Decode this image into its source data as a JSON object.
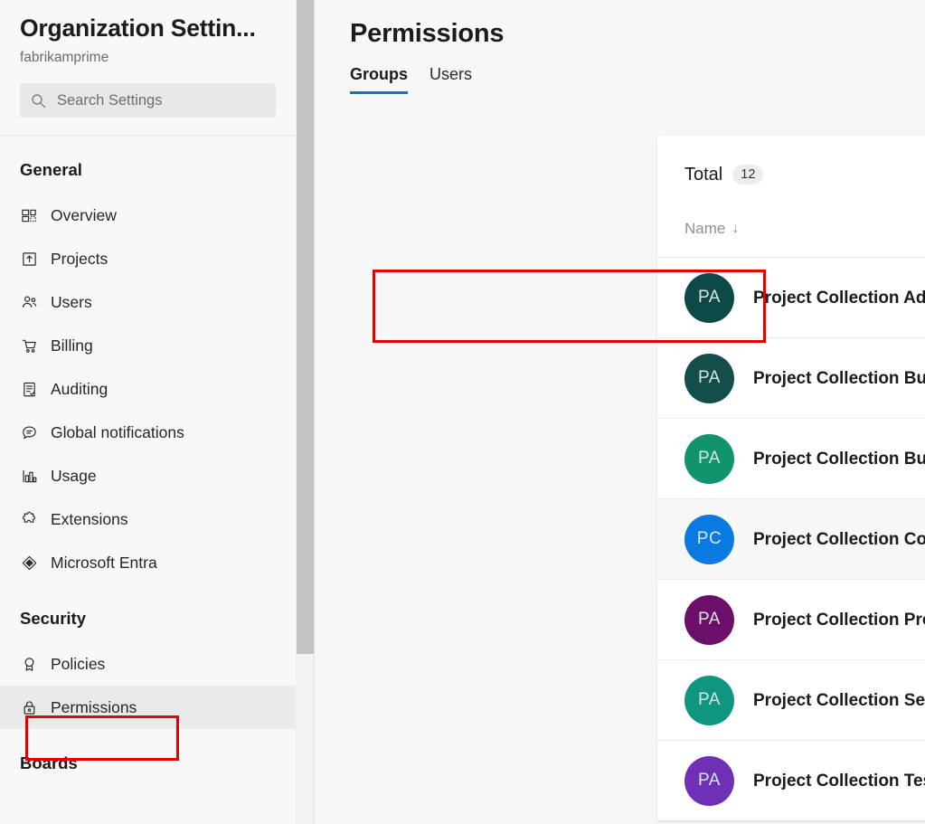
{
  "sidebar": {
    "org_title": "Organization Settin...",
    "org_subtitle": "fabrikamprime",
    "search": {
      "placeholder": "Search Settings",
      "value": "",
      "icon": "search-icon"
    },
    "sections": [
      {
        "title": "General",
        "items": [
          {
            "label": "Overview",
            "icon": "dashboard-icon",
            "selected": false
          },
          {
            "label": "Projects",
            "icon": "project-box-icon",
            "selected": false
          },
          {
            "label": "Users",
            "icon": "people-icon",
            "selected": false
          },
          {
            "label": "Billing",
            "icon": "shopping-cart-icon",
            "selected": false
          },
          {
            "label": "Auditing",
            "icon": "clipboard-check-icon",
            "selected": false
          },
          {
            "label": "Global notifications",
            "icon": "speech-bubble-icon",
            "selected": false
          },
          {
            "label": "Usage",
            "icon": "bar-chart-icon",
            "selected": false
          },
          {
            "label": "Extensions",
            "icon": "puzzle-piece-icon",
            "selected": false
          },
          {
            "label": "Microsoft Entra",
            "icon": "entra-diamond-icon",
            "selected": false
          }
        ]
      },
      {
        "title": "Security",
        "items": [
          {
            "label": "Policies",
            "icon": "ribbon-badge-icon",
            "selected": false
          },
          {
            "label": "Permissions",
            "icon": "lock-icon",
            "selected": true
          }
        ]
      },
      {
        "title": "Boards",
        "items": []
      }
    ]
  },
  "main": {
    "page_title": "Permissions",
    "tabs": [
      {
        "label": "Groups",
        "active": true
      },
      {
        "label": "Users",
        "active": false
      }
    ],
    "total": {
      "label": "Total",
      "count": "12"
    },
    "column_header": {
      "label": "Name",
      "sort_arrow": "↓"
    },
    "rows": [
      {
        "initials": "PA",
        "name": "Project Collection Administrators",
        "color": "#0d4a47",
        "alt": false
      },
      {
        "initials": "PA",
        "name": "Project Collection Build Administrators",
        "color": "#134e4a",
        "alt": false
      },
      {
        "initials": "PA",
        "name": "Project Collection Build Service Accounts",
        "color": "#11946e",
        "alt": false
      },
      {
        "initials": "PC",
        "name": "Project Collection Contributors",
        "color": "#0a7ae0",
        "alt": true
      },
      {
        "initials": "PA",
        "name": "Project Collection Proxy Service Accounts",
        "color": "#6b0f6b",
        "alt": false
      },
      {
        "initials": "PA",
        "name": "Project Collection Service Accounts",
        "color": "#0f9680",
        "alt": false
      },
      {
        "initials": "PA",
        "name": "Project Collection Test Service Accounts",
        "color": "#7030b5",
        "alt": false
      }
    ]
  },
  "annotations": {
    "accent_color": "#e60000",
    "permissions_highlight": "Permissions",
    "first_row_highlight": "Project Collection Administrators"
  }
}
